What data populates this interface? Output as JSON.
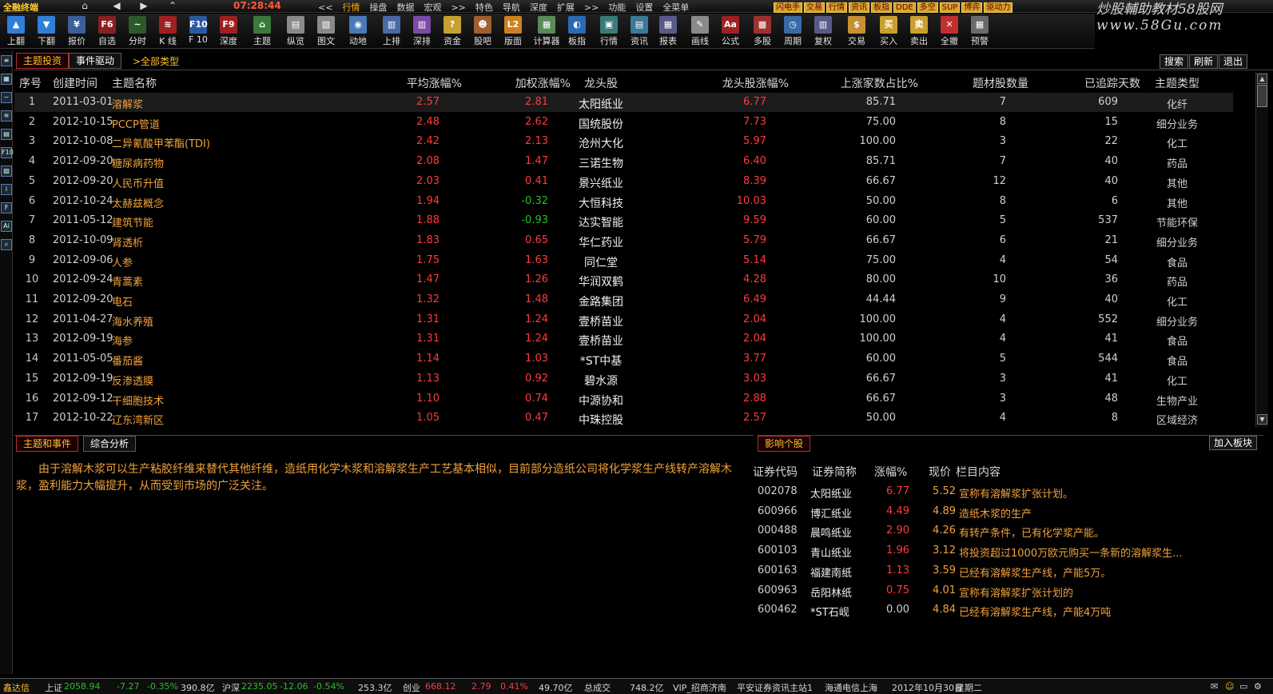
{
  "menubar": {
    "app_title": "全融终端",
    "nav_icons": [
      {
        "name": "home-icon",
        "glyph": "⌂"
      },
      {
        "name": "back-icon",
        "glyph": "◀"
      },
      {
        "name": "forward-icon",
        "glyph": "▶"
      },
      {
        "name": "collapse-icon",
        "glyph": "⌃"
      }
    ],
    "clock": "07:28:44",
    "items": [
      "<<",
      "行情",
      "操盘",
      "数据",
      "宏观",
      ">>",
      "特色",
      "导航",
      "深度",
      "扩展",
      ">>",
      "功能",
      "设置",
      "全菜单"
    ],
    "active_item": "行情",
    "quick_tags": [
      "闪电手",
      "交易",
      "行情",
      "资讯",
      "板指",
      "DDE",
      "多空",
      "SUP",
      "博弈",
      "驱动力"
    ],
    "brand_line1": "炒股輔助教材58股网",
    "brand_line2": "www.58Gu.com"
  },
  "toolbar": {
    "buttons": [
      {
        "label": "上翻",
        "icon": "arrow-up-icon",
        "glyph": "▲",
        "color": "#2f7fd8"
      },
      {
        "label": "下翻",
        "icon": "arrow-down-icon",
        "glyph": "▼",
        "color": "#2f7fd8"
      },
      {
        "label": "报价",
        "icon": "quote-icon",
        "glyph": "¥",
        "color": "#3a5f9a"
      },
      {
        "label": "自选",
        "icon": "watchlist-icon",
        "glyph": "F6",
        "color": "#8a2020"
      },
      {
        "label": "分时",
        "icon": "intraday-chart-icon",
        "glyph": "~",
        "color": "#2a5a2a"
      },
      {
        "label": "K 线",
        "icon": "kline-chart-icon",
        "glyph": "≋",
        "color": "#a02020"
      },
      {
        "label": "F 10",
        "icon": "f10-icon",
        "glyph": "F10",
        "color": "#2b5aa5"
      },
      {
        "label": "深度",
        "icon": "depth-icon",
        "glyph": "F9",
        "color": "#a02020"
      },
      {
        "label": "主题",
        "icon": "theme-home-icon",
        "glyph": "⌂",
        "color": "#3a7a3a"
      },
      {
        "label": "纵览",
        "icon": "overview-icon",
        "glyph": "▤",
        "color": "#8a8a8a"
      },
      {
        "label": "图文",
        "icon": "picture-text-icon",
        "glyph": "▧",
        "color": "#8a8a8a"
      },
      {
        "label": "动地",
        "icon": "earth-icon",
        "glyph": "◉",
        "color": "#4a7ab5"
      },
      {
        "label": "上排",
        "icon": "rank-up-icon",
        "glyph": "▥",
        "color": "#4a6aa5"
      },
      {
        "label": "深排",
        "icon": "rank-depth-icon",
        "glyph": "▥",
        "color": "#7a4aa5"
      },
      {
        "label": "资金",
        "icon": "fund-icon",
        "glyph": "?",
        "color": "#c8a030"
      },
      {
        "label": "股吧",
        "icon": "forum-icon",
        "glyph": "☻",
        "color": "#a06030"
      },
      {
        "label": "版面",
        "icon": "level2-icon",
        "glyph": "L2",
        "color": "#d08020"
      },
      {
        "label": "计算器",
        "icon": "calculator-icon",
        "glyph": "▦",
        "color": "#5a8a5a"
      },
      {
        "label": "板指",
        "icon": "sector-index-icon",
        "glyph": "◐",
        "color": "#2a6ab5"
      },
      {
        "label": "行情",
        "icon": "market-icon",
        "glyph": "▣",
        "color": "#3a7a7a"
      },
      {
        "label": "资讯",
        "icon": "news-icon",
        "glyph": "▤",
        "color": "#3a7a9a"
      },
      {
        "label": "报表",
        "icon": "report-icon",
        "glyph": "▦",
        "color": "#5a5a8a"
      },
      {
        "label": "画线",
        "icon": "draw-line-icon",
        "glyph": "✎",
        "color": "#8a8a8a"
      },
      {
        "label": "公式",
        "icon": "formula-icon",
        "glyph": "Aa",
        "color": "#a02020"
      },
      {
        "label": "多股",
        "icon": "multi-stock-icon",
        "glyph": "▩",
        "color": "#a03030"
      },
      {
        "label": "周期",
        "icon": "period-icon",
        "glyph": "◷",
        "color": "#3a6aa5"
      },
      {
        "label": "复权",
        "icon": "adjust-icon",
        "glyph": "▥",
        "color": "#5a5a8a"
      },
      {
        "label": "交易",
        "icon": "trade-icon",
        "glyph": "$",
        "color": "#c89030"
      },
      {
        "label": "买入",
        "icon": "buy-icon",
        "glyph": "买",
        "color": "#c8a030"
      },
      {
        "label": "卖出",
        "icon": "sell-icon",
        "glyph": "卖",
        "color": "#c8a030"
      },
      {
        "label": "全撤",
        "icon": "cancel-all-icon",
        "glyph": "✕",
        "color": "#c03030"
      },
      {
        "label": "预警",
        "icon": "alert-icon",
        "glyph": "▦",
        "color": "#6a6a6a"
      }
    ]
  },
  "leftbar": {
    "icons": [
      {
        "name": "list-view-icon",
        "glyph": "≡"
      },
      {
        "name": "table-view-icon",
        "glyph": "▦"
      },
      {
        "name": "trend-chart-icon",
        "glyph": "~"
      },
      {
        "name": "kline-view-icon",
        "glyph": "≋"
      },
      {
        "name": "report-view-icon",
        "glyph": "▤"
      },
      {
        "name": "f10-view-icon",
        "glyph": "F10"
      },
      {
        "name": "news-view-icon",
        "glyph": "▧"
      },
      {
        "name": "info-view-icon",
        "glyph": "i"
      },
      {
        "name": "f10-alt-icon",
        "glyph": "F"
      },
      {
        "name": "ai-view-icon",
        "glyph": "Ai"
      },
      {
        "name": "search-view-icon",
        "glyph": "⌕"
      }
    ]
  },
  "panel": {
    "tab_theme": "主题投资",
    "tab_event": "事件驱动",
    "filter": ">全部类型",
    "search": "搜索",
    "refresh": "刷新",
    "exit": "退出"
  },
  "table": {
    "headers": [
      "序号",
      "创建时间",
      "主题名称",
      "平均涨幅%",
      "加权涨幅%",
      "龙头股",
      "龙头股涨幅%",
      "上涨家数占比%",
      "题材股数量",
      "已追踪天数",
      "主题类型"
    ],
    "rows": [
      {
        "no": "1",
        "date": "2011-03-01",
        "name": "溶解浆",
        "avg": "2.57",
        "avg_dir": "up",
        "weighted": "2.81",
        "w_dir": "up",
        "leader": "太阳纸业",
        "leader_chg": "6.77",
        "ratio": "85.71",
        "count": "7",
        "days": "609",
        "type": "化纤"
      },
      {
        "no": "2",
        "date": "2012-10-15",
        "name": "PCCP管道",
        "avg": "2.48",
        "avg_dir": "up",
        "weighted": "2.62",
        "w_dir": "up",
        "leader": "国统股份",
        "leader_chg": "7.73",
        "ratio": "75.00",
        "count": "8",
        "days": "15",
        "type": "细分业务"
      },
      {
        "no": "3",
        "date": "2012-10-08",
        "name": "二异氰酸甲苯酯(TDI)",
        "avg": "2.42",
        "avg_dir": "up",
        "weighted": "2.13",
        "w_dir": "up",
        "leader": "沧州大化",
        "leader_chg": "5.97",
        "ratio": "100.00",
        "count": "3",
        "days": "22",
        "type": "化工"
      },
      {
        "no": "4",
        "date": "2012-09-20",
        "name": "糖尿病药物",
        "avg": "2.08",
        "avg_dir": "up",
        "weighted": "1.47",
        "w_dir": "up",
        "leader": "三诺生物",
        "leader_chg": "6.40",
        "ratio": "85.71",
        "count": "7",
        "days": "40",
        "type": "药品"
      },
      {
        "no": "5",
        "date": "2012-09-20",
        "name": "人民币升值",
        "avg": "2.03",
        "avg_dir": "up",
        "weighted": "0.41",
        "w_dir": "up",
        "leader": "景兴纸业",
        "leader_chg": "8.39",
        "ratio": "66.67",
        "count": "12",
        "days": "40",
        "type": "其他"
      },
      {
        "no": "6",
        "date": "2012-10-24",
        "name": "太赫兹概念",
        "avg": "1.94",
        "avg_dir": "up",
        "weighted": "-0.32",
        "w_dir": "down",
        "leader": "大恒科技",
        "leader_chg": "10.03",
        "ratio": "50.00",
        "count": "8",
        "days": "6",
        "type": "其他"
      },
      {
        "no": "7",
        "date": "2011-05-12",
        "name": "建筑节能",
        "avg": "1.88",
        "avg_dir": "up",
        "weighted": "-0.93",
        "w_dir": "down",
        "leader": "达实智能",
        "leader_chg": "9.59",
        "ratio": "60.00",
        "count": "5",
        "days": "537",
        "type": "节能环保"
      },
      {
        "no": "8",
        "date": "2012-10-09",
        "name": "肾透析",
        "avg": "1.83",
        "avg_dir": "up",
        "weighted": "0.65",
        "w_dir": "up",
        "leader": "华仁药业",
        "leader_chg": "5.79",
        "ratio": "66.67",
        "count": "6",
        "days": "21",
        "type": "细分业务"
      },
      {
        "no": "9",
        "date": "2012-09-06",
        "name": "人参",
        "avg": "1.75",
        "avg_dir": "up",
        "weighted": "1.63",
        "w_dir": "up",
        "leader": "同仁堂",
        "leader_chg": "5.14",
        "ratio": "75.00",
        "count": "4",
        "days": "54",
        "type": "食品"
      },
      {
        "no": "10",
        "date": "2012-09-24",
        "name": "青蒿素",
        "avg": "1.47",
        "avg_dir": "up",
        "weighted": "1.26",
        "w_dir": "up",
        "leader": "华润双鹤",
        "leader_chg": "4.28",
        "ratio": "80.00",
        "count": "10",
        "days": "36",
        "type": "药品"
      },
      {
        "no": "11",
        "date": "2012-09-20",
        "name": "电石",
        "avg": "1.32",
        "avg_dir": "up",
        "weighted": "1.48",
        "w_dir": "up",
        "leader": "金路集团",
        "leader_chg": "6.49",
        "ratio": "44.44",
        "count": "9",
        "days": "40",
        "type": "化工"
      },
      {
        "no": "12",
        "date": "2011-04-27",
        "name": "海水养殖",
        "avg": "1.31",
        "avg_dir": "up",
        "weighted": "1.24",
        "w_dir": "up",
        "leader": "壹桥苗业",
        "leader_chg": "2.04",
        "ratio": "100.00",
        "count": "4",
        "days": "552",
        "type": "细分业务"
      },
      {
        "no": "13",
        "date": "2012-09-19",
        "name": "海参",
        "avg": "1.31",
        "avg_dir": "up",
        "weighted": "1.24",
        "w_dir": "up",
        "leader": "壹桥苗业",
        "leader_chg": "2.04",
        "ratio": "100.00",
        "count": "4",
        "days": "41",
        "type": "食品"
      },
      {
        "no": "14",
        "date": "2011-05-05",
        "name": "番茄酱",
        "avg": "1.14",
        "avg_dir": "up",
        "weighted": "1.03",
        "w_dir": "up",
        "leader": "*ST中基",
        "leader_chg": "3.77",
        "ratio": "60.00",
        "count": "5",
        "days": "544",
        "type": "食品"
      },
      {
        "no": "15",
        "date": "2012-09-19",
        "name": "反渗透膜",
        "avg": "1.13",
        "avg_dir": "up",
        "weighted": "0.92",
        "w_dir": "up",
        "leader": "碧水源",
        "leader_chg": "3.03",
        "ratio": "66.67",
        "count": "3",
        "days": "41",
        "type": "化工"
      },
      {
        "no": "16",
        "date": "2012-09-12",
        "name": "干细胞技术",
        "avg": "1.10",
        "avg_dir": "up",
        "weighted": "0.74",
        "w_dir": "up",
        "leader": "中源协和",
        "leader_chg": "2.88",
        "ratio": "66.67",
        "count": "3",
        "days": "48",
        "type": "生物产业"
      },
      {
        "no": "17",
        "date": "2012-10-22",
        "name": "辽东湾新区",
        "avg": "1.05",
        "avg_dir": "up",
        "weighted": "0.47",
        "w_dir": "up",
        "leader": "中珠控股",
        "leader_chg": "2.57",
        "ratio": "50.00",
        "count": "4",
        "days": "8",
        "type": "区域经济"
      }
    ]
  },
  "detail": {
    "tab_event": "主题和事件",
    "tab_analysis": "综合分析",
    "description": "由于溶解木浆可以生产粘胶纤维来替代其他纤维，造纸用化学木浆和溶解浆生产工艺基本相似，目前部分造纸公司将化学浆生产线转产溶解木浆，盈利能力大幅提升，从而受到市场的广泛关注。"
  },
  "influence": {
    "tab": "影响个股",
    "add_button": "加入板块",
    "headers": [
      "证券代码",
      "证券简称",
      "涨幅%",
      "现价",
      "栏目内容"
    ],
    "rows": [
      {
        "code": "002078",
        "name": "太阳纸业",
        "chg": "6.77",
        "chg_dir": "up",
        "price": "5.52",
        "content": "宣称有溶解浆扩张计划。"
      },
      {
        "code": "600966",
        "name": "博汇纸业",
        "chg": "4.49",
        "chg_dir": "up",
        "price": "4.89",
        "content": "造纸木浆的生产"
      },
      {
        "code": "000488",
        "name": "晨鸣纸业",
        "chg": "2.90",
        "chg_dir": "up",
        "price": "4.26",
        "content": "有转产条件，已有化学浆产能。"
      },
      {
        "code": "600103",
        "name": "青山纸业",
        "chg": "1.96",
        "chg_dir": "up",
        "price": "3.12",
        "content": "将投资超过1000万欧元购买一条新的溶解浆生..."
      },
      {
        "code": "600163",
        "name": "福建南纸",
        "chg": "1.13",
        "chg_dir": "up",
        "price": "3.59",
        "content": "已经有溶解浆生产线，产能5万。"
      },
      {
        "code": "600963",
        "name": "岳阳林纸",
        "chg": "0.75",
        "chg_dir": "up",
        "price": "4.01",
        "content": "宣称有溶解浆扩张计划的"
      },
      {
        "code": "600462",
        "name": "*ST石岘",
        "chg": "0.00",
        "chg_dir": "flat",
        "price": "4.84",
        "content": "已经有溶解浆生产线，产能4万吨"
      }
    ]
  },
  "statusbar": {
    "brand": "鑫达信",
    "sh_label": "上证",
    "sh_index": "2058.94",
    "sh_chg": "-7.27",
    "sh_pct": "-0.35%",
    "sh_amount": "390.8亿",
    "sz_label": "沪深",
    "sz_index": "2235.05",
    "sz_chg": "-12.06",
    "sz_pct": "-0.54%",
    "sz_amount": "253.3亿",
    "cy_label": "创业",
    "cy_index": "668.12",
    "cy_chg": "2.79",
    "cy_pct": "0.41%",
    "cy_amount": "49.70亿",
    "total_label": "总成交",
    "total_amount": "748.2亿",
    "server": "VIP_招商济南",
    "broker": "平安证券资讯主站1",
    "isp": "海通电信上海",
    "date": "2012年10月30日",
    "weekday": "星期二"
  },
  "colors": {
    "up": "#ff3a3a",
    "down": "#26c026",
    "accent": "#ffbf2b",
    "name": "#f2a23a"
  }
}
